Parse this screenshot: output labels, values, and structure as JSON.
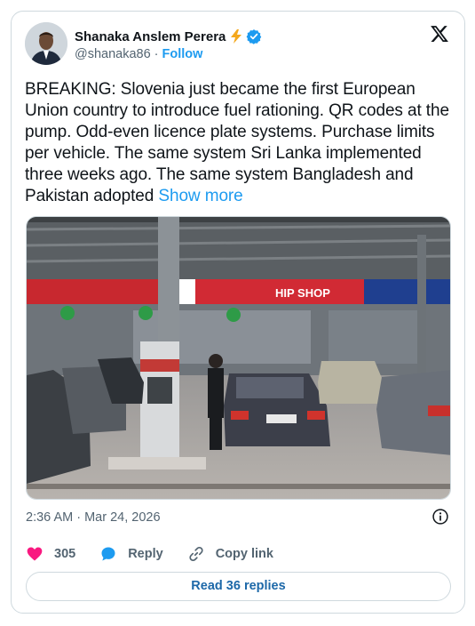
{
  "tweet": {
    "author": {
      "display_name": "Shanaka Anslem Perera",
      "handle": "@shanaka86",
      "separator": "·",
      "follow_label": "Follow",
      "badge_emoji_icon": "lightning-bolt-icon",
      "verified_icon": "verified-badge-icon"
    },
    "text": "BREAKING: Slovenia just became the first European Union country to introduce fuel rationing. QR codes at the pump. Odd-even licence plate systems. Purchase limits per vehicle. The same system Sri Lanka implemented three weeks ago. The same system Bangladesh and Pakistan adopted",
    "show_more_label": "Show more",
    "photo": {
      "sign_text": "HIP SHOP"
    },
    "timestamp": "2:36 AM · Mar 24, 2026",
    "actions": {
      "likes_count": "305",
      "reply_label": "Reply",
      "copy_link_label": "Copy link"
    },
    "read_replies_label": "Read 36 replies"
  },
  "colors": {
    "accent": "#1d9bf0",
    "like": "#f91880",
    "secondary_text": "#536471"
  }
}
